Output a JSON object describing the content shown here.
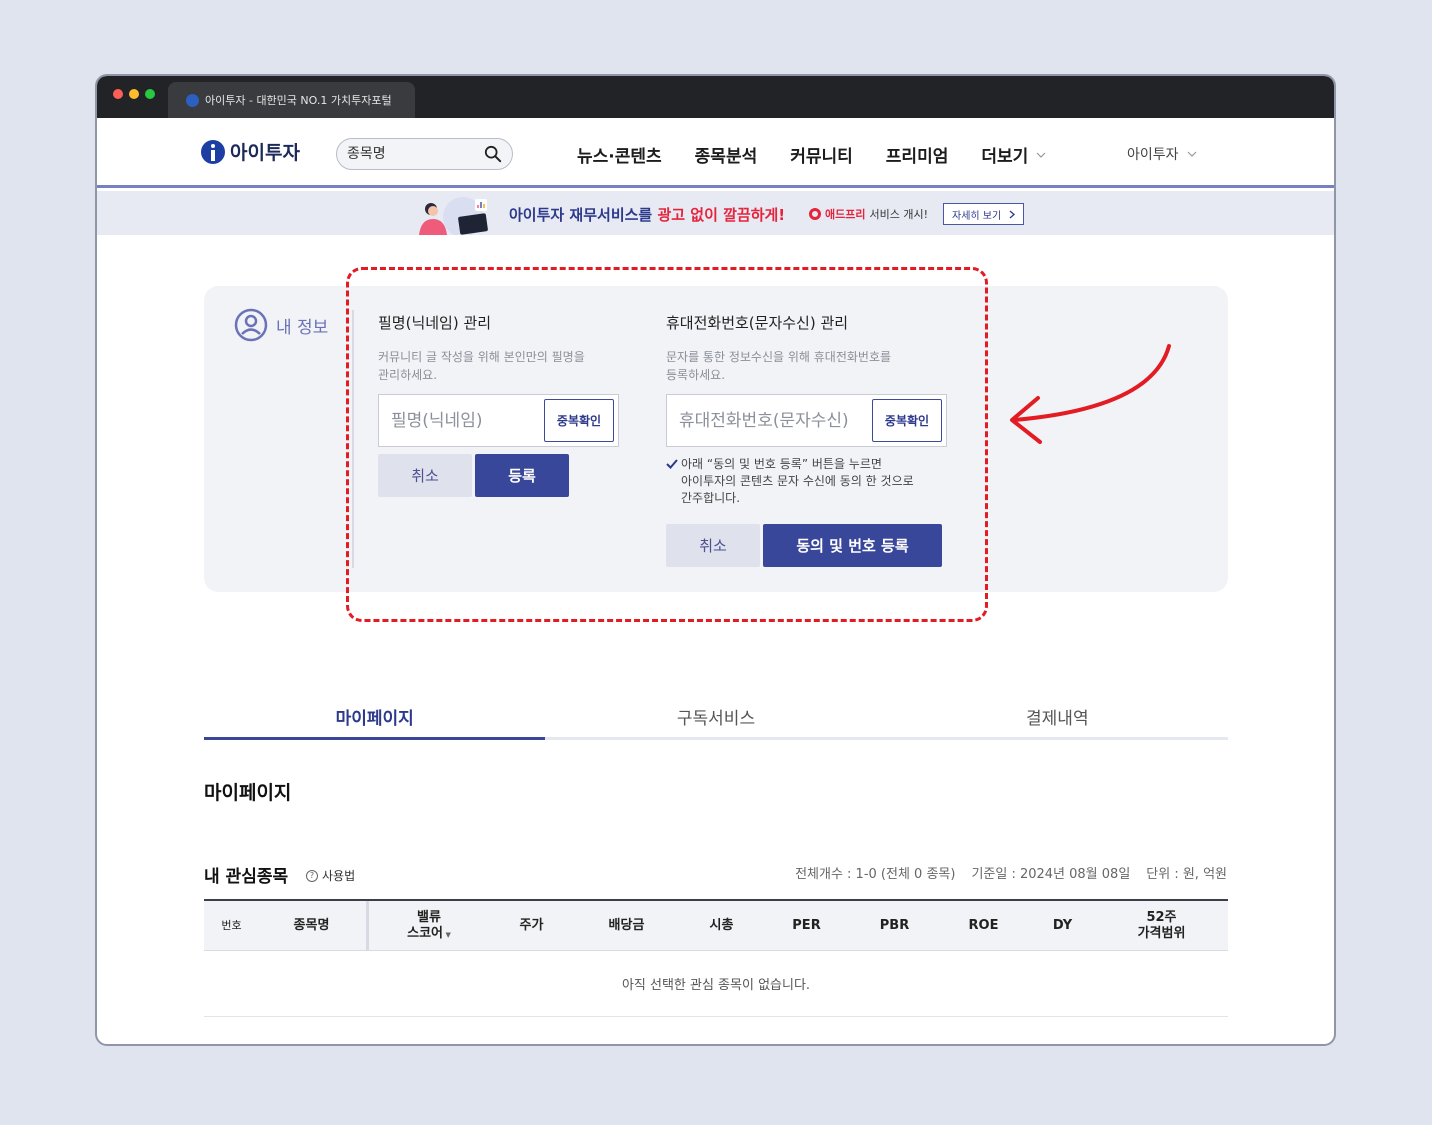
{
  "browser": {
    "tab_title": "아이투자 - 대한민국 NO.1 가치투자포털"
  },
  "header": {
    "logo_text": "아이투자",
    "search_placeholder": "종목명",
    "menu": [
      {
        "label": "뉴스·콘텐츠"
      },
      {
        "label": "종목분석"
      },
      {
        "label": "커뮤니티"
      },
      {
        "label": "프리미엄"
      },
      {
        "label": "더보기"
      }
    ],
    "user_menu": "아이투자"
  },
  "banner": {
    "text_main": "아이투자 재무서비스를 ",
    "text_highlight": "광고 없이 깔끔하게!",
    "badge_brand": "애드프리",
    "badge_text": "서비스 개시!",
    "button": "자세히 보기"
  },
  "my_info": {
    "title": "내 정보",
    "nickname": {
      "title": "필명(닉네임) 관리",
      "desc_1": "커뮤니티 글 작성을 위해 본인만의 필명을",
      "desc_2": "관리하세요.",
      "placeholder": "필명(닉네임)",
      "dup_button": "중복확인",
      "cancel": "취소",
      "submit": "등록"
    },
    "phone": {
      "title": "휴대전화번호(문자수신) 관리",
      "desc_1": "문자를 통한 정보수신을 위해 휴대전화번호를",
      "desc_2": "등록하세요.",
      "placeholder": "휴대전화번호(문자수신)",
      "dup_button": "중복확인",
      "consent_1": "아래 “동의 및 번호 등록” 버튼을 누르면",
      "consent_2": "아이투자의 콘텐츠 문자 수신에 동의 한 것으로",
      "consent_3": "간주합니다.",
      "cancel": "취소",
      "submit": "동의 및 번호 등록"
    }
  },
  "tabs": [
    {
      "label": "마이페이지",
      "active": true
    },
    {
      "label": "구독서비스",
      "active": false
    },
    {
      "label": "결제내역",
      "active": false
    }
  ],
  "page_heading": "마이페이지",
  "watchlist": {
    "title": "내 관심종목",
    "howto": "사용법",
    "count": "전체개수 : 1-0 (전체 0 종목)",
    "base_date": "기준일 : 2024년 08월 08일",
    "unit": "단위 : 원, 억원",
    "columns": {
      "no": "번호",
      "name": "종목명",
      "value_1": "밸류",
      "value_2": "스코어",
      "price": "주가",
      "dividend": "배당금",
      "mcap": "시총",
      "per": "PER",
      "pbr": "PBR",
      "roe": "ROE",
      "dy": "DY",
      "range_1": "52주",
      "range_2": "가격범위"
    },
    "empty_message": "아직 선택한 관심 종목이 없습니다."
  },
  "colors": {
    "brand_navy": "#39479a",
    "accent_red": "#e31b23",
    "highlight_red": "#e5243c"
  }
}
